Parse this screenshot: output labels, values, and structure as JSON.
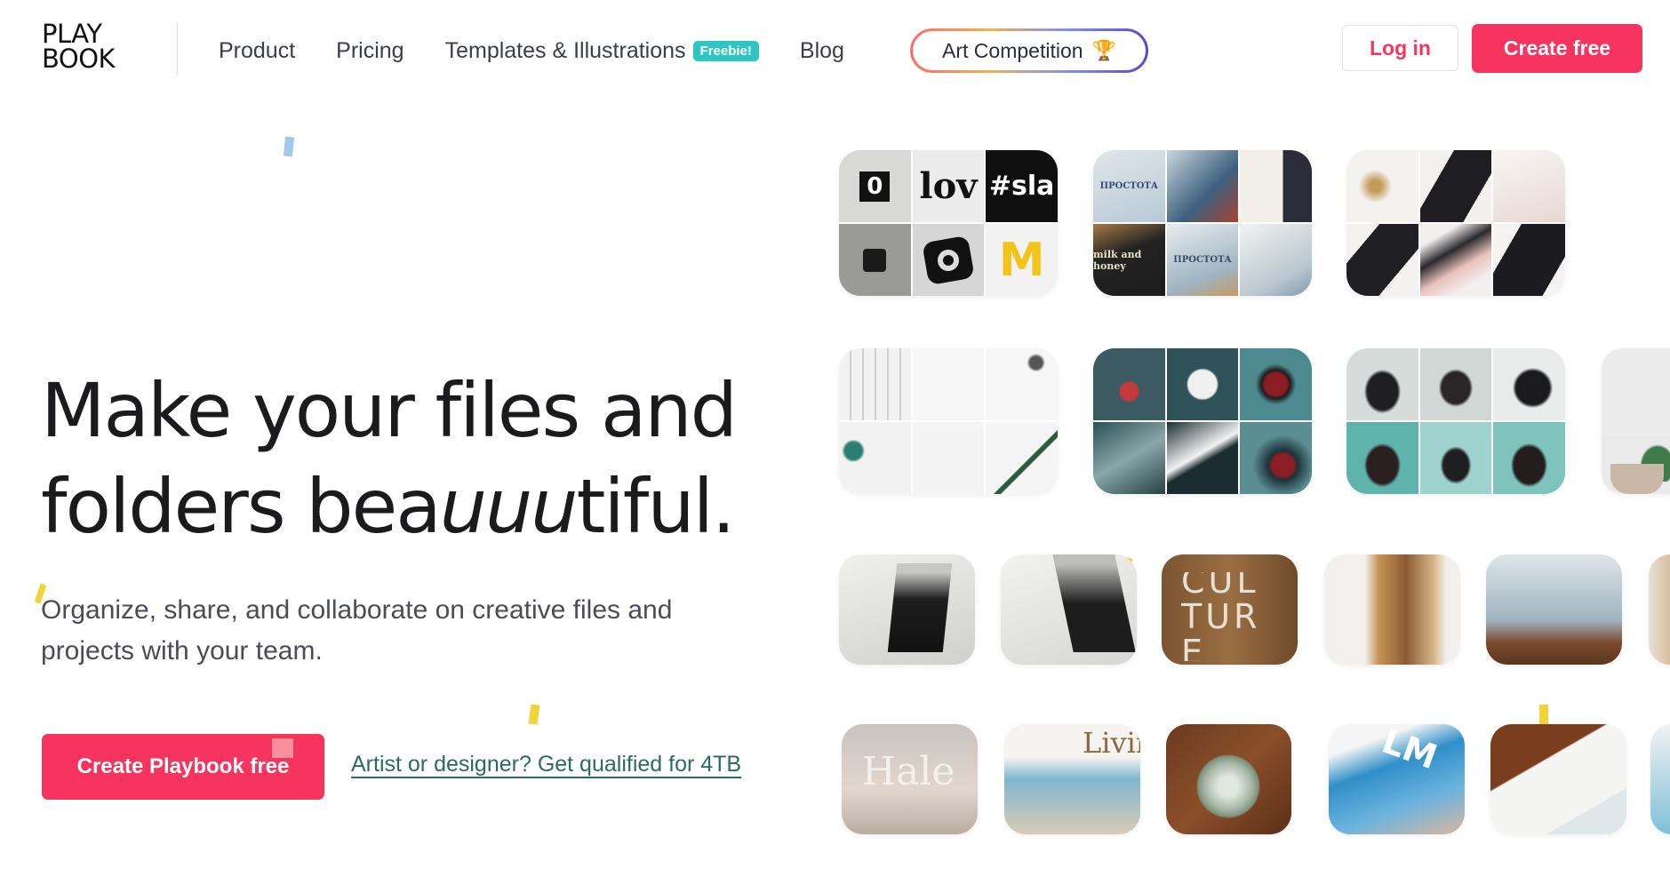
{
  "brand": {
    "line1": "PLAY",
    "line2": "BOOK"
  },
  "nav": {
    "items": [
      {
        "label": "Product"
      },
      {
        "label": "Pricing"
      },
      {
        "label": "Templates & Illustrations"
      },
      {
        "label": "Blog"
      }
    ],
    "freebie_badge": "Freebie!",
    "art_competition": "Art Competition",
    "trophy_icon": "🏆"
  },
  "auth": {
    "login": "Log in",
    "create": "Create free"
  },
  "hero": {
    "title_line1": "Make your files and",
    "title_line2_a": "folders bea",
    "title_line2_b": "uuu",
    "title_line2_c": "tiful.",
    "subtitle": "Organize, share, and collaborate on creative files and projects with your team.",
    "cta": "Create Playbook free",
    "artist_link": "Artist or designer? Get qualified for 4TB"
  },
  "gallery": {
    "tile1": {
      "c1": "0",
      "c2": "lov",
      "c3": "#sla",
      "c6": "M"
    },
    "tile2": {
      "c1": "ПРОСТОТА",
      "c4": "milk and honey",
      "c5": "ПРОСТОТА"
    },
    "row3_culture": "CULTURE",
    "row4_hale": "Hale",
    "row4_livin": "Livin",
    "row4_lm": "LM"
  },
  "colors": {
    "accent": "#f7345e",
    "teal": "#2ec6c2",
    "link": "#2d6a63"
  }
}
